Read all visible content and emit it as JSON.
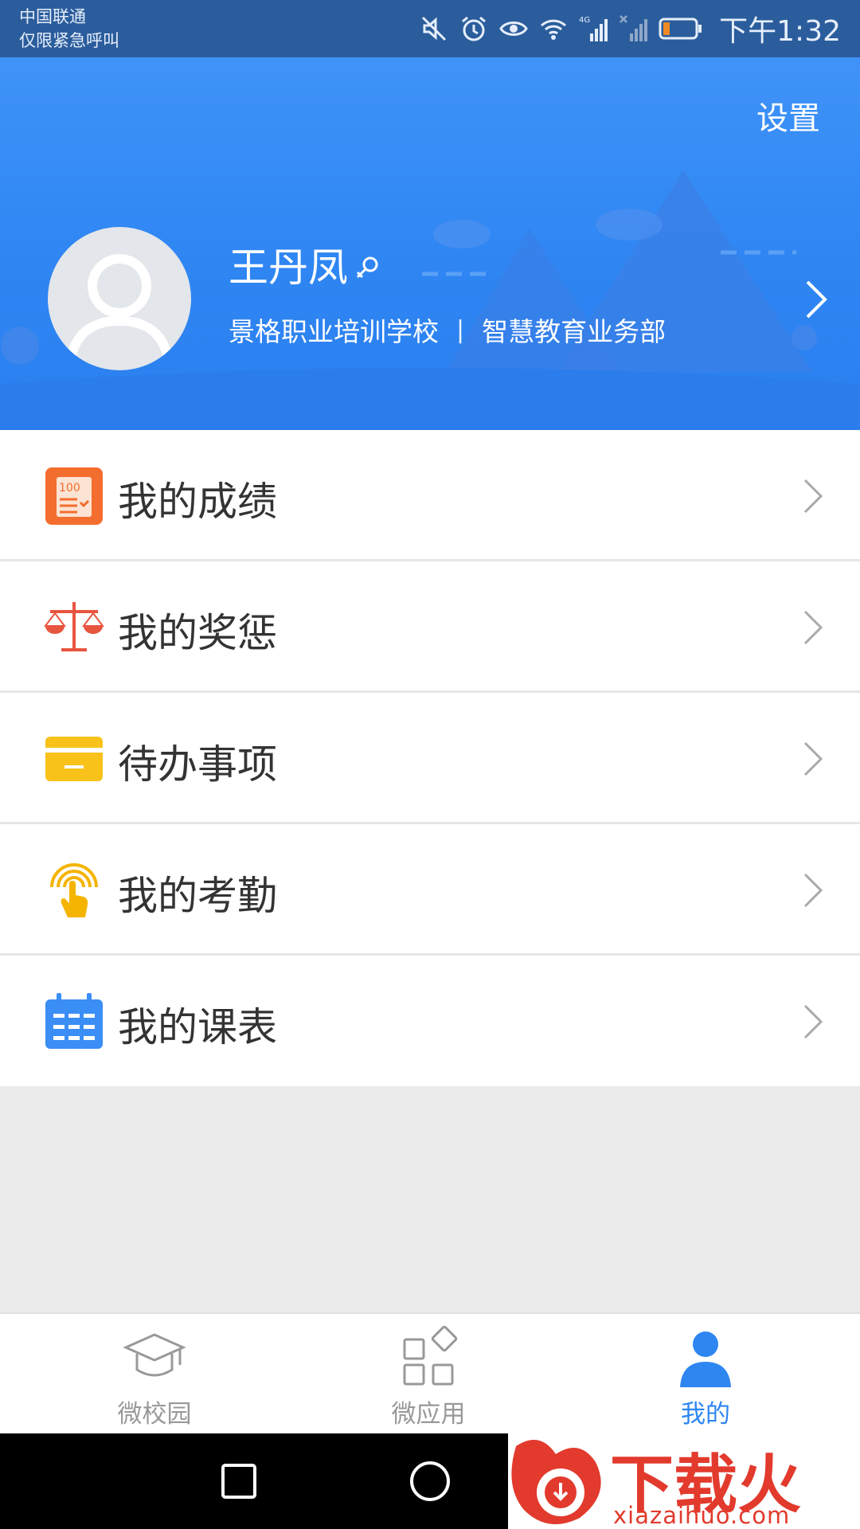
{
  "status_bar": {
    "carrier_line1": "中国联通",
    "carrier_line2": "仅限紧急呼叫",
    "time": "下午1:32",
    "battery_color": "#f08a24"
  },
  "header": {
    "settings_label": "设置",
    "user_name": "王丹凤",
    "school": "景格职业培训学校",
    "separator": "|",
    "department": "智慧教育业务部",
    "accent_color": "#2f86f3"
  },
  "menu": {
    "items": [
      {
        "label": "我的成绩",
        "icon": "score-report-icon"
      },
      {
        "label": "我的奖惩",
        "icon": "balance-scale-icon"
      },
      {
        "label": "待办事项",
        "icon": "todo-card-icon"
      },
      {
        "label": "我的考勤",
        "icon": "tap-attendance-icon"
      },
      {
        "label": "我的课表",
        "icon": "timetable-icon"
      }
    ]
  },
  "bottom_nav": {
    "tabs": [
      {
        "label": "微校园",
        "icon": "graduation-cap-icon",
        "active": false
      },
      {
        "label": "微应用",
        "icon": "apps-grid-icon",
        "active": false
      },
      {
        "label": "我的",
        "icon": "person-icon",
        "active": true
      }
    ]
  },
  "watermark": {
    "title": "下载火",
    "url": "xiazaihuo.com"
  }
}
